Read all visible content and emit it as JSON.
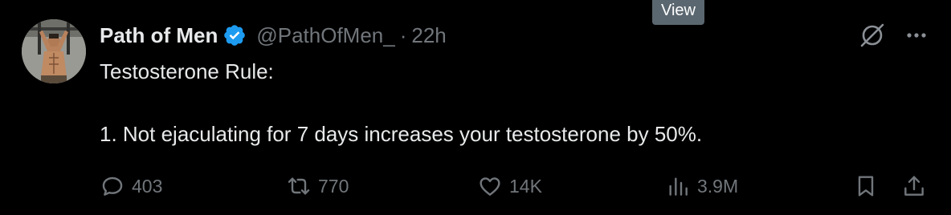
{
  "tooltip": {
    "label": "View"
  },
  "author": {
    "display_name": "Path of Men",
    "handle": "@PathOfMen_",
    "separator": "·",
    "time": "22h"
  },
  "tweet": {
    "text": "Testosterone Rule:\n\n1. Not ejaculating for 7 days increases your testosterone by 50%."
  },
  "metrics": {
    "replies": "403",
    "reposts": "770",
    "likes": "14K",
    "views": "3.9M"
  },
  "icons": {
    "reply": "reply-icon",
    "repost": "repost-icon",
    "like": "like-icon",
    "views": "views-icon",
    "bookmark": "bookmark-icon",
    "share": "share-icon",
    "grok": "grok-icon",
    "more": "more-icon",
    "verified": "verified-badge-icon"
  },
  "colors": {
    "background": "#000000",
    "text": "#e7e9ea",
    "muted": "#71767b",
    "verified": "#1d9bf0",
    "tooltip": "#5b6770"
  }
}
